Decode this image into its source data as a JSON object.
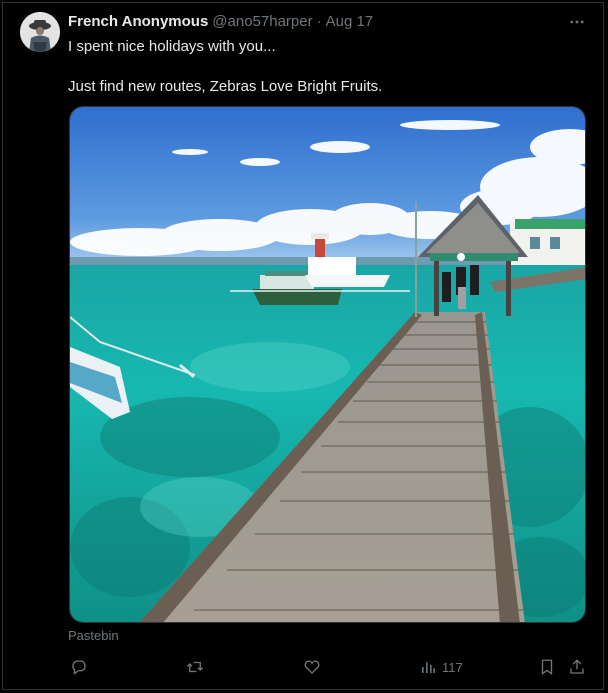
{
  "tweet": {
    "author_name": "French Anonymous",
    "handle": "@ano57harper",
    "separator": "·",
    "date": "Aug 17",
    "text_line1": "I spent nice holidays with you...",
    "text_line2": "Just find new routes, Zebras Love Bright Fruits.",
    "media_source": "Pastebin",
    "views": "117"
  },
  "icons": {
    "more": "more-icon",
    "reply": "reply-icon",
    "retweet": "retweet-icon",
    "like": "heart-icon",
    "views": "views-icon",
    "bookmark": "bookmark-icon",
    "share": "share-icon"
  },
  "colors": {
    "background": "#000000",
    "text": "#e7e9ea",
    "muted": "#71767b",
    "border": "#2f3336"
  }
}
